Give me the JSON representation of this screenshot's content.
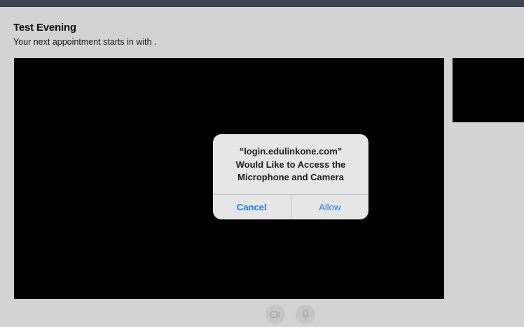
{
  "header": {
    "title": "Test Evening",
    "subtitle": "Your next appointment starts in with ."
  },
  "permission_dialog": {
    "message_lines": [
      "“login.edulinkone.com”",
      "Would Like to Access the",
      "Microphone and Camera"
    ],
    "cancel_label": "Cancel",
    "allow_label": "Allow",
    "accent_color": "#1a7cf0"
  },
  "controls": {
    "camera_icon": "video-camera-icon",
    "microphone_icon": "microphone-icon"
  }
}
